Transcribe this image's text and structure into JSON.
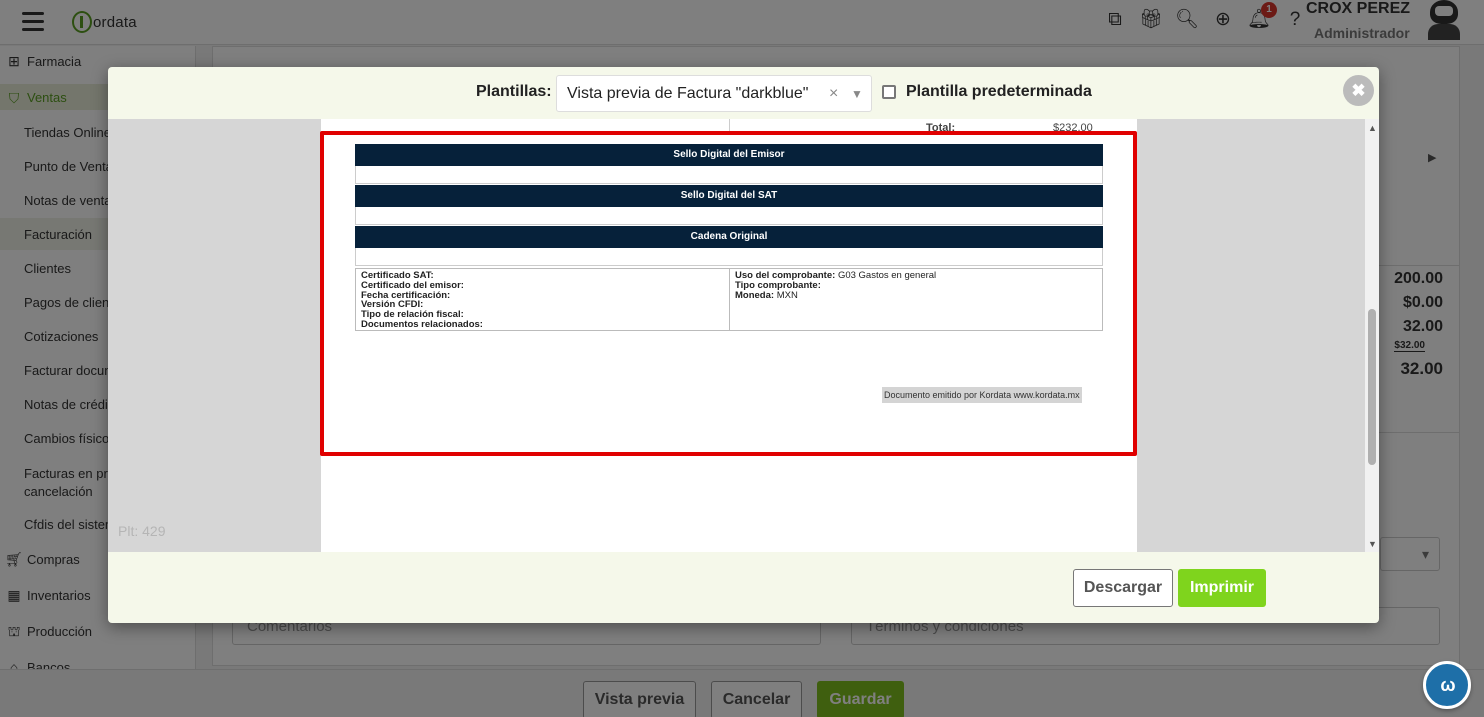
{
  "app": {
    "logo_text": "ordata"
  },
  "topbar": {
    "notification_count": "1",
    "user_name": "CROX PEREZ",
    "user_role": "Administrador"
  },
  "sidebar": {
    "top_items": [
      {
        "label": "Farmacia",
        "icon": "plus-box-icon"
      },
      {
        "label": "Ventas",
        "icon": "ventas-icon"
      },
      {
        "label": "Compras",
        "icon": "cart-icon"
      },
      {
        "label": "Inventarios",
        "icon": "boxes-icon"
      },
      {
        "label": "Producción",
        "icon": "factory-icon"
      },
      {
        "label": "Bancos",
        "icon": "bank-icon"
      }
    ],
    "ventas_items": [
      "Tiendas Online",
      "Punto de Venta",
      "Notas de venta",
      "Facturación",
      "Clientes",
      "Pagos de client",
      "Cotizaciones",
      "Facturar docum",
      "Notas de crédit",
      "Cambios físicos",
      "Facturas en pro",
      "cancelación",
      "Cfdis del sistem"
    ]
  },
  "background": {
    "totals": [
      "200.00",
      "$0.00",
      "32.00",
      "$32.00",
      "32.00"
    ],
    "comments_placeholder": "Comentarios",
    "terms_placeholder": "Términos y condiciones",
    "buttons": {
      "preview": "Vista previa",
      "cancel": "Cancelar",
      "save": "Guardar"
    }
  },
  "modal": {
    "templates_label": "Plantillas:",
    "template_selected": "Vista previa de Factura \"darkblue\"",
    "clear_symbol": "×",
    "default_template_label": "Plantilla predeterminada",
    "close_symbol": "✖",
    "plt_label": "Plt: 429",
    "download_label": "Descargar",
    "print_label": "Imprimir"
  },
  "invoice": {
    "cutoff_total_label": "Total:",
    "cutoff_total_value": "$232.00",
    "sections": [
      "Sello Digital del Emisor",
      "Sello Digital del SAT",
      "Cadena Original"
    ],
    "left_fields": [
      "Certificado SAT:",
      "Certificado del emisor:",
      "Fecha certificación:",
      "Versión CFDI:",
      "Tipo de relación fiscal:",
      "Documentos relacionados:"
    ],
    "right_fields": [
      {
        "label": "Uso del comprobante:",
        "value": "G03 Gastos en general"
      },
      {
        "label": "Tipo comprobante:",
        "value": ""
      },
      {
        "label": "Moneda:",
        "value": "MXN"
      }
    ],
    "footer_note": "Documento emitido por Kordata www.kordata.mx"
  },
  "colors": {
    "brand_green": "#7fd41d",
    "invoice_header": "#06213a",
    "highlight_red": "#e00000"
  }
}
